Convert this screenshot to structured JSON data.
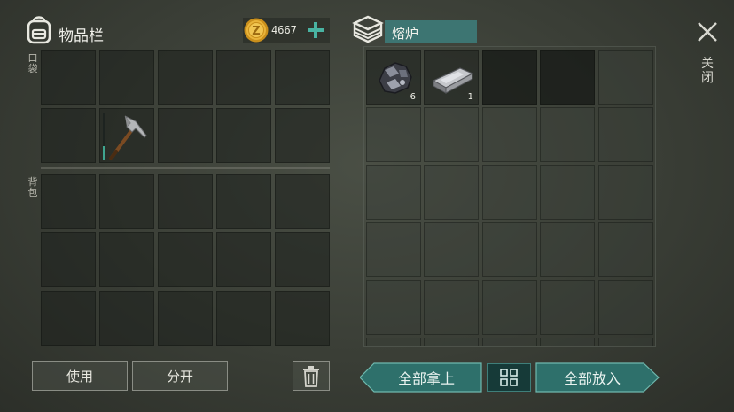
{
  "left_panel": {
    "title": "物品栏",
    "icon": "backpack-icon",
    "pocket_label": "口袋",
    "backpack_label": "背包",
    "pocket_slots": [
      {
        "item": null
      },
      {
        "item": null
      },
      {
        "item": null
      },
      {
        "item": null
      },
      {
        "item": null
      },
      {
        "item": null
      },
      {
        "item": "pickaxe",
        "icon": "pickaxe-icon",
        "durability": 0.3
      },
      {
        "item": null
      },
      {
        "item": null
      },
      {
        "item": null
      }
    ],
    "backpack_rows": 3,
    "backpack_cols": 5
  },
  "currency": {
    "amount": "4667",
    "icon": "coin-icon",
    "coin_letter": "Z",
    "add_icon": "plus-icon",
    "color": "#e0a92a"
  },
  "right_panel": {
    "title": "熔炉",
    "icon": "furnace-icon",
    "slots": [
      {
        "item": "ore",
        "icon": "ore-icon",
        "count": "6"
      },
      {
        "item": "ingot",
        "icon": "ingot-icon",
        "count": "1"
      }
    ]
  },
  "close": {
    "label": "关闭",
    "icon": "close-icon"
  },
  "buttons": {
    "use": "使用",
    "split": "分开",
    "trash_icon": "trash-icon",
    "take_all": "全部拿上",
    "sort_icon": "grid-icon",
    "put_all": "全部放入"
  },
  "colors": {
    "accent": "#49b3a2",
    "title_bar": "#3d7572",
    "action_button": "#2e706b"
  }
}
